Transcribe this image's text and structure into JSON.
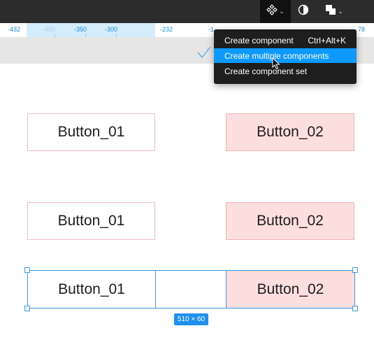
{
  "toolbar": {
    "component_tool_icon": "component-icon",
    "theme_icon": "contrast-icon",
    "boolean_icon": "boolean-ops-icon"
  },
  "ruler": {
    "ticks": [
      "-432",
      "-400",
      "-350",
      "-300",
      "-232",
      "-1",
      "78"
    ]
  },
  "menu": {
    "items": [
      {
        "label": "Create component",
        "shortcut": "Ctrl+Alt+K"
      },
      {
        "label": "Create multiple components",
        "shortcut": ""
      },
      {
        "label": "Create component set",
        "shortcut": ""
      }
    ],
    "highlighted_index": 1
  },
  "canvas": {
    "row1": {
      "left": "Button_01",
      "right": "Button_02"
    },
    "row2": {
      "left": "Button_01",
      "right": "Button_02"
    },
    "row3": {
      "left": "Button_01",
      "right": "Button_02"
    },
    "selection_size": "510 × 60"
  },
  "colors": {
    "accent": "#0d99ff",
    "button2_fill": "#fddede",
    "button1_border": "#f2b8cd"
  }
}
